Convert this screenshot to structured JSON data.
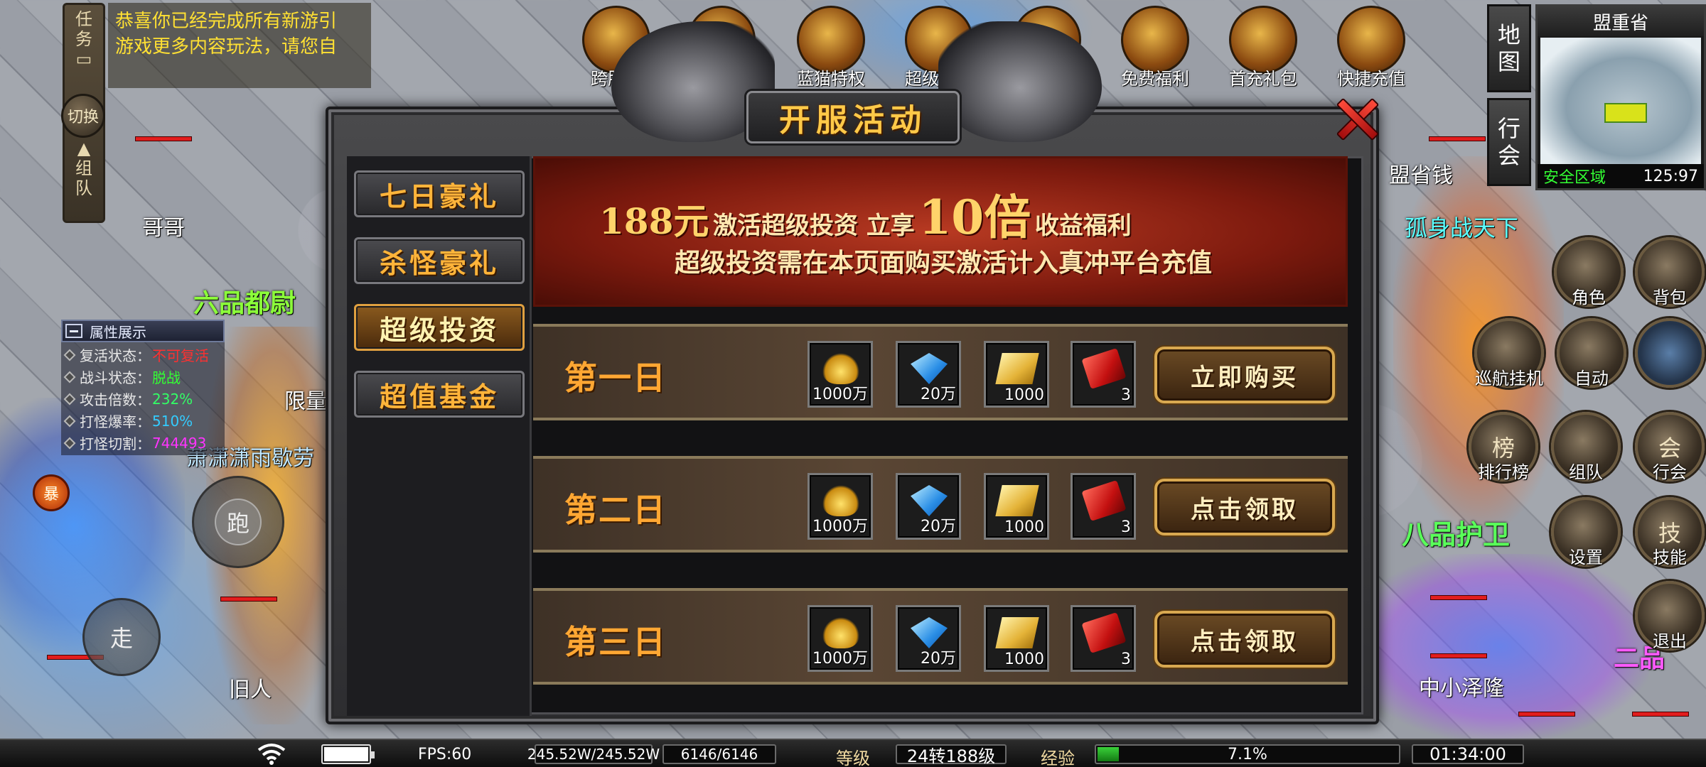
{
  "quest": {
    "tab_task": [
      "任",
      "务"
    ],
    "tab_team": [
      "组",
      "队"
    ],
    "switch_label": "切换",
    "notice_lines": [
      "恭喜你已经完成所有新游引",
      "游戏更多内容玩法，请您自"
    ]
  },
  "top_icons": [
    "跨服战",
    "",
    "蓝猫特权",
    "超级赞助",
    "",
    "免费福利",
    "首充礼包",
    "快捷充值"
  ],
  "minimap": {
    "side_buttons": [
      [
        "地",
        "图"
      ],
      [
        "行",
        "会"
      ]
    ],
    "region": "盟重省",
    "safe_zone": "安全区域",
    "coords": "125:97"
  },
  "attributes": {
    "title": "属性展示",
    "rows": [
      {
        "key": "复活状态：",
        "value": "不可复活",
        "color": "#ff3030"
      },
      {
        "key": "战斗状态：",
        "value": "脱战",
        "color": "#33ff33"
      },
      {
        "key": "攻击倍数：",
        "value": "232%",
        "color": "#33ff66"
      },
      {
        "key": "打怪爆率：",
        "value": "510%",
        "color": "#33ccff"
      },
      {
        "key": "打怪切割：",
        "value": "744493",
        "color": "#ff33ff"
      }
    ]
  },
  "world_labels": {
    "player_left": "哥哥",
    "title_left": "六品都尉",
    "limit": "限量",
    "player_mid": "萧潇潇雨歇劳",
    "player_bottom": "旧人",
    "player_right": "孤身战天下",
    "title_right": "八品护卫",
    "player_right_bottom": "中小泽隆",
    "title_right_bottom": "二品",
    "province_money": "盟省钱",
    "skill_red": "暴"
  },
  "controls": {
    "run": "跑",
    "walk": "走"
  },
  "right_buttons": [
    {
      "label": "角色",
      "glyph": ""
    },
    {
      "label": "背包",
      "glyph": ""
    },
    {
      "label": "巡航挂机",
      "glyph": ""
    },
    {
      "label": "自动",
      "glyph": ""
    },
    {
      "label": "",
      "glyph": ""
    },
    {
      "label": "排行榜",
      "glyph": "榜"
    },
    {
      "label": "组队",
      "glyph": ""
    },
    {
      "label": "行会",
      "glyph": "会"
    },
    {
      "label": "设置",
      "glyph": ""
    },
    {
      "label": "技能",
      "glyph": "技"
    },
    {
      "label": "退出",
      "glyph": ""
    }
  ],
  "dialog": {
    "title": "开服活动",
    "tabs": [
      "七日豪礼",
      "杀怪豪礼",
      "超级投资",
      "超值基金"
    ],
    "active_tab": 2,
    "banner": {
      "amount": "188元",
      "text_a": "激活超级投资 立享",
      "multiplier": "10倍",
      "text_b": "收益福利",
      "line2": "超级投资需在本页面购买激活计入真冲平台充值"
    },
    "days": [
      {
        "label": "第一日",
        "rewards": [
          {
            "icon": "gold-ingot-icon",
            "count": "1000万"
          },
          {
            "icon": "diamond-icon",
            "count": "20万"
          },
          {
            "icon": "scroll-icon",
            "count": "1000"
          },
          {
            "icon": "red-packet-icon",
            "count": "3"
          }
        ],
        "button": "立即购买"
      },
      {
        "label": "第二日",
        "rewards": [
          {
            "icon": "gold-ingot-icon",
            "count": "1000万"
          },
          {
            "icon": "diamond-icon",
            "count": "20万"
          },
          {
            "icon": "scroll-icon",
            "count": "1000"
          },
          {
            "icon": "red-packet-icon",
            "count": "3"
          }
        ],
        "button": "点击领取"
      },
      {
        "label": "第三日",
        "rewards": [
          {
            "icon": "gold-ingot-icon",
            "count": "1000万"
          },
          {
            "icon": "diamond-icon",
            "count": "20万"
          },
          {
            "icon": "scroll-icon",
            "count": "1000"
          },
          {
            "icon": "red-packet-icon",
            "count": "3"
          }
        ],
        "button": "点击领取"
      }
    ]
  },
  "status_bar": {
    "fps": "FPS:60",
    "hp": "245.52W/245.52W",
    "mp": "6146/6146",
    "level_label": "等级",
    "level": "24转188级",
    "exp_label": "经验",
    "exp_text": "7.1%",
    "exp_fraction": 0.071,
    "battery_fraction": 1.0,
    "time": "01:34:00"
  },
  "colors": {
    "gold_text": "#ffc948",
    "tab_text": "#ffb43a",
    "safe_zone": "#33ff33",
    "hp_red": "#e21d1d"
  }
}
